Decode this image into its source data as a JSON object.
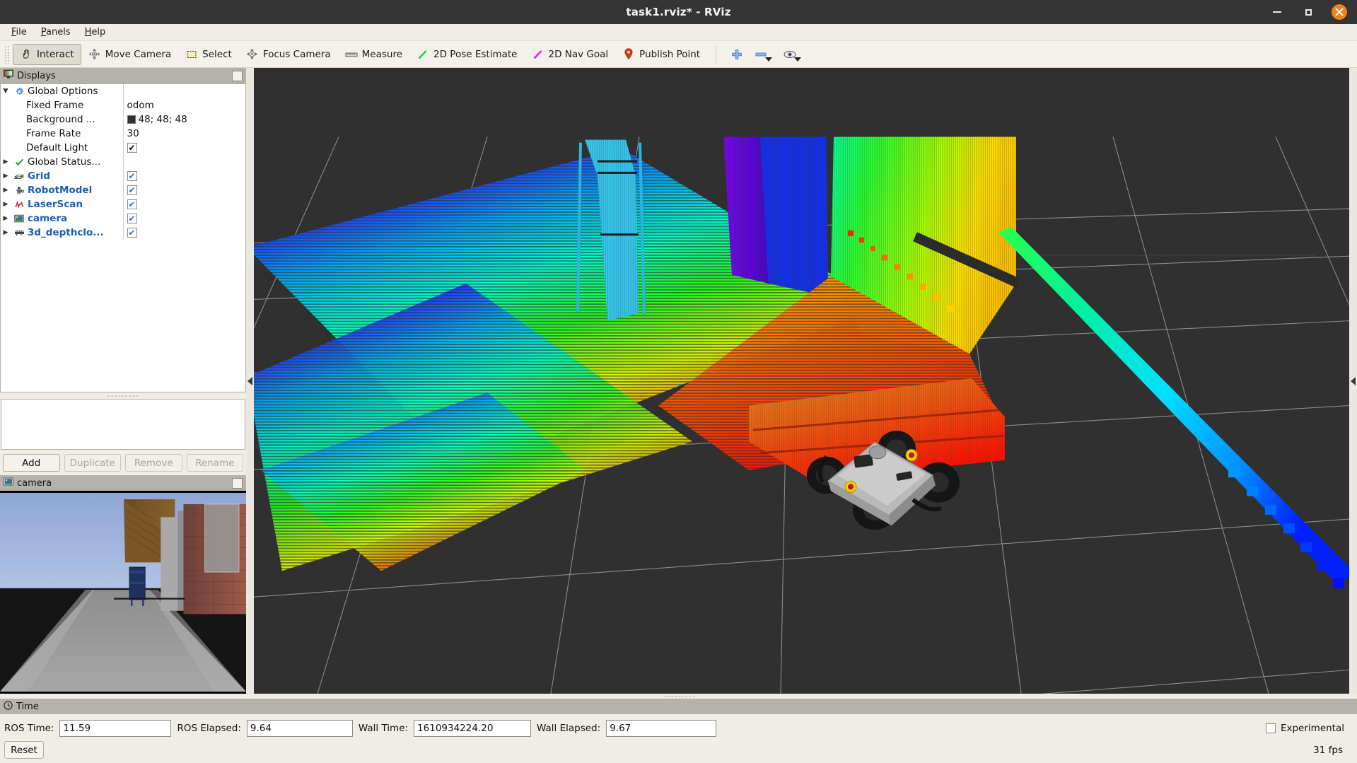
{
  "window": {
    "title": "task1.rviz* - RViz",
    "controls": {
      "minimize": "minimize-icon",
      "maximize": "maximize-icon",
      "close": "close-icon"
    }
  },
  "menubar": {
    "items": [
      "File",
      "Panels",
      "Help"
    ]
  },
  "toolbar": {
    "buttons": [
      {
        "label": "Interact",
        "icon": "hand-cursor-icon",
        "active": true
      },
      {
        "label": "Move Camera",
        "icon": "move-camera-icon",
        "active": false
      },
      {
        "label": "Select",
        "icon": "select-rect-icon",
        "active": false
      },
      {
        "label": "Focus Camera",
        "icon": "focus-camera-icon",
        "active": false
      },
      {
        "label": "Measure",
        "icon": "ruler-icon",
        "active": false
      },
      {
        "label": "2D Pose Estimate",
        "icon": "green-arrow-icon",
        "active": false
      },
      {
        "label": "2D Nav Goal",
        "icon": "magenta-arrow-icon",
        "active": false
      },
      {
        "label": "Publish Point",
        "icon": "map-pin-icon",
        "active": false
      }
    ],
    "extra_icons": [
      "plus-icon",
      "minus-icon",
      "eye-icon"
    ]
  },
  "displays_panel": {
    "title": "Displays",
    "rows": [
      {
        "name": "Global Options",
        "value": "",
        "icon": "gear-icon",
        "expander": "down",
        "bold": false,
        "indent": false,
        "check": null
      },
      {
        "name": "Fixed Frame",
        "value": "odom",
        "icon": "",
        "expander": "",
        "bold": false,
        "indent": true,
        "check": null
      },
      {
        "name": "Background ...",
        "value": "48; 48; 48",
        "icon": "",
        "expander": "",
        "bold": false,
        "indent": true,
        "check": null,
        "swatch": "#303030"
      },
      {
        "name": "Frame Rate",
        "value": "30",
        "icon": "",
        "expander": "",
        "bold": false,
        "indent": true,
        "check": null
      },
      {
        "name": "Default Light",
        "value": "",
        "icon": "",
        "expander": "",
        "bold": false,
        "indent": true,
        "check": "black"
      },
      {
        "name": "Global Status...",
        "value": "",
        "icon": "check-ok-icon",
        "expander": "right",
        "bold": false,
        "indent": false,
        "check": null
      },
      {
        "name": "Grid",
        "value": "",
        "icon": "grid-icon",
        "expander": "right",
        "bold": true,
        "indent": false,
        "check": "blue"
      },
      {
        "name": "RobotModel",
        "value": "",
        "icon": "robot-icon",
        "expander": "right",
        "bold": true,
        "indent": false,
        "check": "blue"
      },
      {
        "name": "LaserScan",
        "value": "",
        "icon": "laserscan-icon",
        "expander": "right",
        "bold": true,
        "indent": false,
        "check": "blue"
      },
      {
        "name": "camera",
        "value": "",
        "icon": "camera-icon",
        "expander": "right",
        "bold": true,
        "indent": false,
        "check": "blue"
      },
      {
        "name": "3d_depthclo...",
        "value": "",
        "icon": "pointcloud-icon",
        "expander": "right",
        "bold": true,
        "indent": false,
        "check": "blue"
      }
    ],
    "buttons": [
      {
        "label": "Add",
        "enabled": true
      },
      {
        "label": "Duplicate",
        "enabled": false
      },
      {
        "label": "Remove",
        "enabled": false
      },
      {
        "label": "Rename",
        "enabled": false
      }
    ]
  },
  "camera_panel": {
    "title": "camera"
  },
  "time_panel": {
    "title": "Time",
    "fields": [
      {
        "label": "ROS Time:",
        "value": "11.59"
      },
      {
        "label": "ROS Elapsed:",
        "value": "9.64"
      },
      {
        "label": "Wall Time:",
        "value": "1610934224.20"
      },
      {
        "label": "Wall Elapsed:",
        "value": "9.67"
      }
    ],
    "experimental_label": "Experimental",
    "experimental_checked": false,
    "reset_label": "Reset",
    "fps": "31 fps"
  },
  "viewport": {
    "background": "#303030",
    "grid_color": "#9a9a9a",
    "description": "3D point cloud scene with rainbow depth coloring, husky robot, laser scan trail"
  },
  "colors": {
    "accent": "#1a5fb4",
    "close_button": "#f0831e",
    "panel_bg": "#efede6",
    "panel_header": "#b5b2ab",
    "viewport_bg": "#303030"
  }
}
